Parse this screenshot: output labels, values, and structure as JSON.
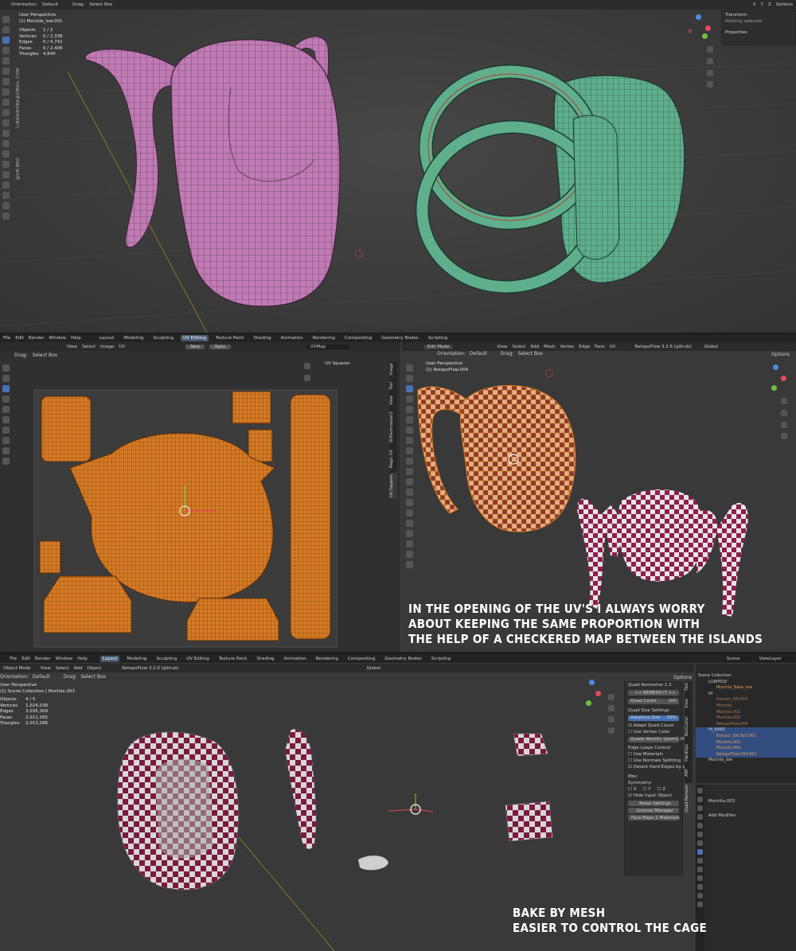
{
  "panel1": {
    "header": {
      "orientation_label": "Orientation:",
      "orientation_value": "Default",
      "drag_label": "Drag:",
      "drag_value": "Select Box",
      "axis_x": "X",
      "axis_y": "Y",
      "axis_z": "Z",
      "options": "Options"
    },
    "viewport": {
      "view_name": "User Perspective",
      "object_name": "(1) Mochila_low.001",
      "stats": [
        {
          "label": "Objects",
          "value": "1 / 2"
        },
        {
          "label": "Vertices",
          "value": "0 / 2,338"
        },
        {
          "label": "Edges",
          "value": "0 / 4,741"
        },
        {
          "label": "Faces",
          "value": "0 / 2,406"
        },
        {
          "label": "Triangles",
          "value": "4,640"
        }
      ],
      "watermark_email": "LIBRAIDOBA@GMAIL.COM",
      "watermark_handle": "@VM.BEO"
    },
    "npanel": {
      "transform": "Transform",
      "nothing_selected": "Nothing selected",
      "properties": "Properties"
    },
    "colors": {
      "pink_mesh": "#c07ab4",
      "green_mesh": "#5fae8c"
    }
  },
  "panel2": {
    "menu": [
      "File",
      "Edit",
      "Render",
      "Window",
      "Help"
    ],
    "workspaces": [
      "Layout",
      "Modeling",
      "Sculpting",
      "UV Editing",
      "Texture Paint",
      "Shading",
      "Animation",
      "Rendering",
      "Compositing",
      "Geometry Nodes",
      "Scripting"
    ],
    "active_workspace": "UV Editing",
    "uv_header": {
      "menus": [
        "View",
        "Select",
        "Image",
        "UV"
      ],
      "new_button": "New",
      "open_button": "Open",
      "uvmap": "UVMap",
      "drag_label": "Drag:",
      "drag_value": "Select Box",
      "uv_squares": "UV Squares"
    },
    "uv_side_tabs": [
      "Image",
      "Tool",
      "View",
      "UVPackmaster2",
      "Magic UV",
      "UV Squares"
    ],
    "viewport_header": {
      "mode": "Edit Mode",
      "menus": [
        "View",
        "Select",
        "Add",
        "Mesh",
        "Vertex",
        "Edge",
        "Face",
        "UV"
      ],
      "orientation_label": "Orientation:",
      "orientation_value": "Default",
      "drag_label": "Drag:",
      "drag_value": "Select Box",
      "retopo": "RetopoFlow 3.2.6 (github)",
      "global": "Global",
      "options": "Options"
    },
    "viewport": {
      "view_name": "User Perspective",
      "object_name": "(1) RetopoFlow.004"
    },
    "caption": [
      "IN THE OPENING OF THE UV'S I ALWAYS WORRY",
      "ABOUT KEEPING THE SAME PROPORTION WITH",
      "THE HELP OF A CHECKERED MAP BETWEEN THE ISLANDS"
    ],
    "colors": {
      "uv_orange": "#d67a24",
      "checker_red": "#8c1f4d"
    }
  },
  "panel3": {
    "menu": [
      "File",
      "Edit",
      "Render",
      "Window",
      "Help"
    ],
    "workspaces": [
      "Layout",
      "Modeling",
      "Sculpting",
      "UV Editing",
      "Texture Paint",
      "Shading",
      "Animation",
      "Rendering",
      "Compositing",
      "Geometry Nodes",
      "Scripting"
    ],
    "active_workspace": "Layout",
    "scene": "Scene",
    "view_layer": "ViewLayer",
    "header": {
      "mode": "Object Mode",
      "menus": [
        "View",
        "Select",
        "Add",
        "Object"
      ],
      "orientation_label": "Orientation:",
      "orientation_value": "Default",
      "drag_label": "Drag:",
      "drag_value": "Select Box",
      "retopo": "RetopoFlow 3.2.6 (github)",
      "global": "Global",
      "options": "Options"
    },
    "viewport": {
      "view_name": "User Perspective",
      "object_name": "(1) Scene Collection | Mochila.003",
      "stats": [
        {
          "label": "Objects",
          "value": "4 / 5"
        },
        {
          "label": "Vertices",
          "value": "1,024,038"
        },
        {
          "label": "Edges",
          "value": "3,035,309"
        },
        {
          "label": "Faces",
          "value": "2,011,395"
        },
        {
          "label": "Triangles",
          "value": "2,013,286"
        }
      ]
    },
    "quad_remesher": {
      "title": "Quad Remesher 1.2",
      "remesh_button": "<< REMESH IT >>",
      "quad_count_label": "Quad Count",
      "quad_count_value": "200",
      "quad_size_settings": "Quad Size Settings",
      "adaptive_size_label": "Adaptive Size",
      "adaptive_size_value": "50%",
      "adapt_quad_count": "Adapt Quad Count",
      "use_vertex_color": "Use Vertex Color",
      "quads_density_label": "Quads density (paint",
      "quads_density_value": "1.00",
      "edge_loops_control": "Edge Loops Control",
      "use_materials": "Use Materials",
      "use_normals_splitting": "Use Normals Splitting",
      "detect_hard_edges": "Detect Hard Edges by an...",
      "misc": "Misc",
      "symmetry": "Symmetry:",
      "sym_x": "X",
      "sym_y": "Y",
      "sym_z": "Z",
      "hide_input_object": "Hide Input Object",
      "reset_settings": "Reset Settings",
      "license_manager": "License Manager",
      "face_maps": "Face Maps 2 Materials"
    },
    "side_tabs": [
      "Tool",
      "View",
      "BoxCutter",
      "HardOps",
      "ARP",
      "Quad Remesh"
    ],
    "outliner": {
      "scene_collection": "Scene Collection",
      "items": [
        {
          "name": "LOWPOLY",
          "sel": false
        },
        {
          "name": "Mochila_Bake_low",
          "sel": false
        },
        {
          "name": "HI",
          "sel": false
        },
        {
          "name": "Extract_SM.003",
          "sel": false
        },
        {
          "name": "Mochila",
          "sel": false
        },
        {
          "name": "Mochila.002",
          "sel": false
        },
        {
          "name": "Mochila.003",
          "sel": false
        },
        {
          "name": "RetopoFlow.004",
          "sel": false
        },
        {
          "name": "HI_BAKE",
          "sel": true
        },
        {
          "name": "Extract_SM.003.001",
          "sel": true
        },
        {
          "name": "Mochila.001",
          "sel": true
        },
        {
          "name": "Mochila.004",
          "sel": true
        },
        {
          "name": "RetopoFlow.004.001",
          "sel": true
        },
        {
          "name": "Mochila_low",
          "sel": false
        }
      ],
      "properties_object": "Mochila.003",
      "add_modifier": "Add Modifier"
    },
    "caption": [
      "BAKE BY MESH",
      "EASIER TO CONTROL THE CAGE"
    ]
  }
}
